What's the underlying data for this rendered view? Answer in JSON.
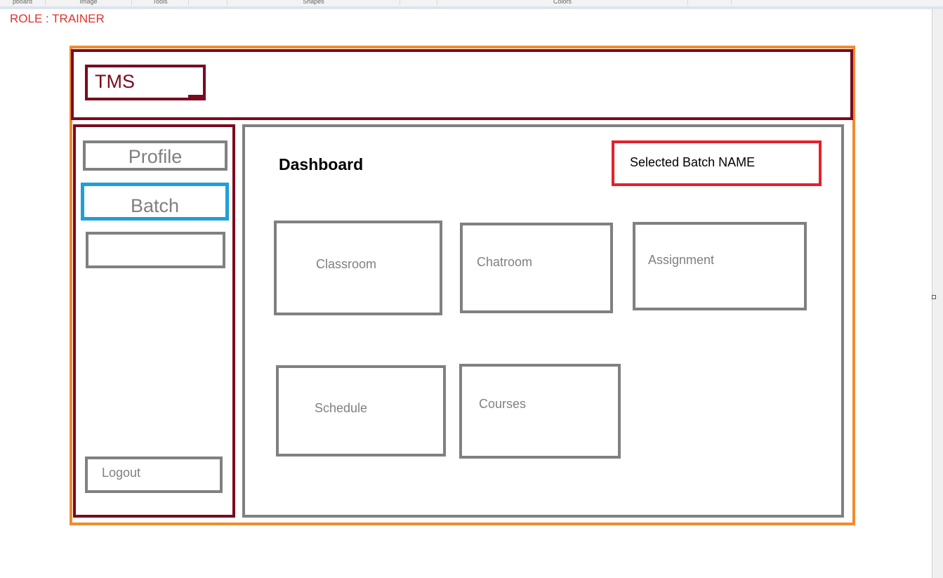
{
  "ribbon": {
    "groups": [
      "pboard",
      "Image",
      "Tools",
      "Shapes",
      "Colors"
    ]
  },
  "role_label": "ROLE : TRAINER",
  "header": {
    "logo_text": "TMS"
  },
  "sidebar": {
    "items": [
      {
        "label": "Profile"
      },
      {
        "label": "Batch"
      },
      {
        "label": ""
      },
      {
        "label": "Logout"
      }
    ]
  },
  "main": {
    "title": "Dashboard",
    "selected_batch": "Selected Batch NAME",
    "tiles": [
      {
        "label": "Classroom"
      },
      {
        "label": "Chatroom"
      },
      {
        "label": "Assignment"
      },
      {
        "label": "Schedule"
      },
      {
        "label": "Courses"
      }
    ]
  },
  "colors": {
    "outer_frame": "#f28a30",
    "maroon": "#7a0a1f",
    "active_item": "#1fa0d8",
    "highlight_box": "#e3212d",
    "neutral_border": "#808080"
  }
}
